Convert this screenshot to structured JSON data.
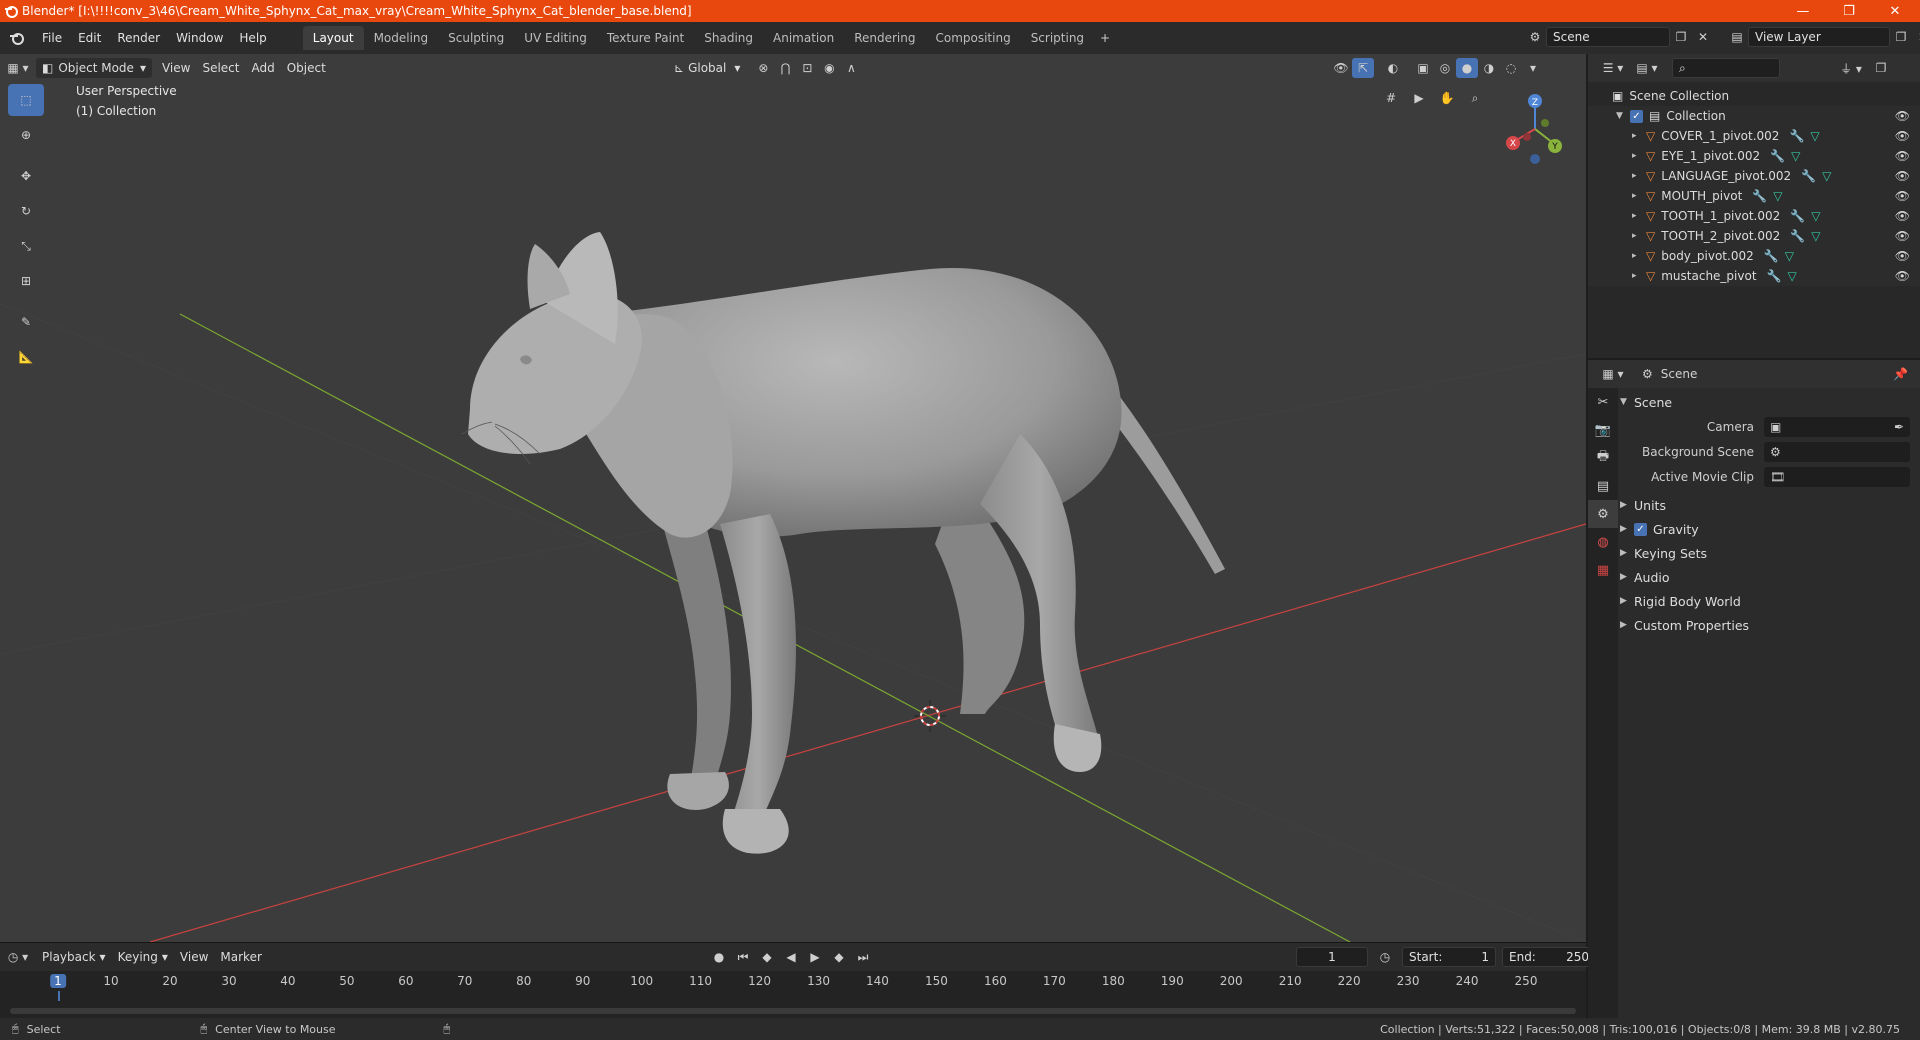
{
  "window": {
    "title": "Blender* [I:\\!!!!conv_3\\46\\Cream_White_Sphynx_Cat_max_vray\\Cream_White_Sphynx_Cat_blender_base.blend]",
    "minimize": "—",
    "maximize": "❐",
    "close": "✕"
  },
  "menu": [
    "File",
    "Edit",
    "Render",
    "Window",
    "Help"
  ],
  "workspaces": [
    {
      "label": "Layout",
      "active": true
    },
    {
      "label": "Modeling"
    },
    {
      "label": "Sculpting"
    },
    {
      "label": "UV Editing"
    },
    {
      "label": "Texture Paint"
    },
    {
      "label": "Shading"
    },
    {
      "label": "Animation"
    },
    {
      "label": "Rendering"
    },
    {
      "label": "Compositing"
    },
    {
      "label": "Scripting"
    }
  ],
  "scene_selector": {
    "value": "Scene"
  },
  "view_layer_selector": {
    "value": "View Layer"
  },
  "viewport": {
    "mode": "Object Mode",
    "menus": [
      "View",
      "Select",
      "Add",
      "Object"
    ],
    "transform_orientation": "Global",
    "info_line1": "User Perspective",
    "info_line2": "(1) Collection",
    "gizmo": {
      "x": "X",
      "y": "Y",
      "z": "Z"
    }
  },
  "outliner": {
    "root": "Scene Collection",
    "collection": "Collection",
    "items": [
      "COVER_1_pivot.002",
      "EYE_1_pivot.002",
      "LANGUAGE_pivot.002",
      "MOUTH_pivot",
      "TOOTH_1_pivot.002",
      "TOOTH_2_pivot.002",
      "body_pivot.002",
      "mustache_pivot"
    ]
  },
  "properties": {
    "context": "Scene",
    "panel_scene": "Scene",
    "camera_label": "Camera",
    "background_scene_label": "Background Scene",
    "active_movie_clip_label": "Active Movie Clip",
    "panels": [
      "Units",
      "Gravity",
      "Keying Sets",
      "Audio",
      "Rigid Body World",
      "Custom Properties"
    ]
  },
  "timeline": {
    "menus": [
      "Playback",
      "Keying",
      "View",
      "Marker"
    ],
    "current_frame": "1",
    "start_label": "Start:",
    "start_value": "1",
    "end_label": "End:",
    "end_value": "250",
    "ruler_labels": [
      "1",
      "10",
      "20",
      "30",
      "40",
      "50",
      "60",
      "70",
      "80",
      "90",
      "100",
      "110",
      "120",
      "130",
      "140",
      "150",
      "160",
      "170",
      "180",
      "190",
      "200",
      "210",
      "220",
      "230",
      "240",
      "250"
    ]
  },
  "statusbar": {
    "select": "Select",
    "center_view": "Center View to Mouse",
    "stats": "Collection | Verts:51,322 | Faces:50,008 | Tris:100,016 | Objects:0/8 | Mem: 39.8 MB | v2.80.75"
  },
  "colors": {
    "title_bar": "#e8480e",
    "accent": "#4772b3",
    "axis_x": "#c8433f",
    "axis_y": "#7ba830",
    "object_icon": "#e8863a",
    "modifier_icon": "#5a9be0",
    "mesh_icon": "#34c7a0"
  }
}
